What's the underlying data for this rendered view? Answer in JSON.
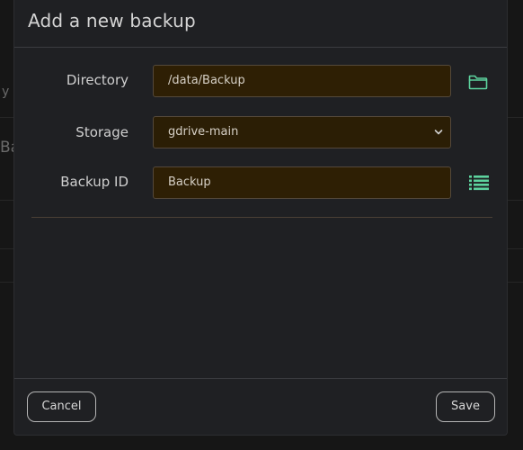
{
  "background": {
    "fragments": [
      "y",
      "Ba"
    ]
  },
  "modal": {
    "title": "Add a new backup",
    "directory": {
      "label": "Directory",
      "value": "/data/Backup",
      "icon": "folder-icon"
    },
    "storage": {
      "label": "Storage",
      "value": "gdrive-main",
      "icon": "chevron-down-icon"
    },
    "backup_id": {
      "label": "Backup ID",
      "value": "Backup",
      "icon": "list-icon"
    },
    "footer": {
      "cancel_label": "Cancel",
      "save_label": "Save"
    }
  },
  "colors": {
    "accent": "#5dd39e",
    "input_bg": "#2e1f04",
    "modal_bg": "#1f2023"
  }
}
